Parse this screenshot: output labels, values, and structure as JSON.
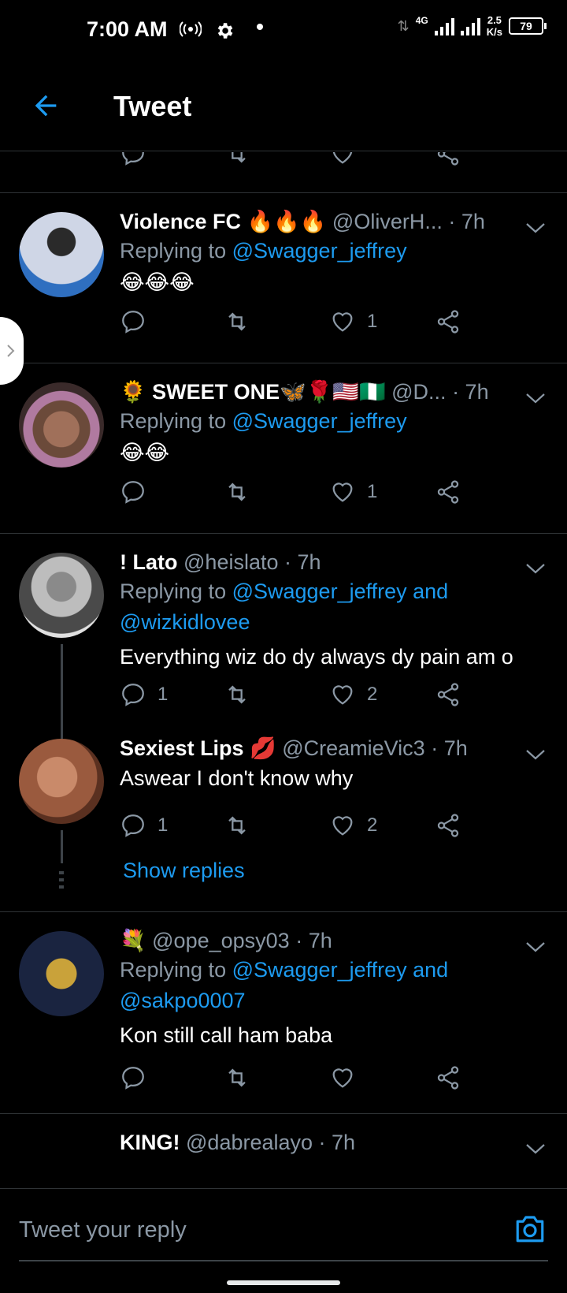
{
  "status_bar": {
    "time": "7:00 AM",
    "network": "4G",
    "speed_value": "2.5",
    "speed_unit": "K/s",
    "battery": "79"
  },
  "header": {
    "title": "Tweet"
  },
  "tweets": [
    {
      "name": "Violence FC 🔥🔥🔥",
      "handle": "@OliverH...",
      "time": "· 7h",
      "reply_prefix": "Replying to ",
      "reply_to": "@Swagger_jeffrey",
      "text": "😂😂😂",
      "replies": "",
      "likes": "1"
    },
    {
      "name": "🌻 SWEET ONE🦋🌹🇺🇸🇳🇬",
      "handle": "@D...",
      "time": "· 7h",
      "reply_prefix": "Replying to ",
      "reply_to": "@Swagger_jeffrey",
      "text": "😂😂",
      "replies": "",
      "likes": "1"
    },
    {
      "name": "! Lato",
      "handle": "@heislato",
      "time": "· 7h",
      "reply_prefix": "Replying to ",
      "reply_to": "@Swagger_jeffrey and",
      "reply_to_2": "@wizkidlovee",
      "text": "Everything wiz do dy always dy pain am o",
      "replies": "1",
      "likes": "2"
    },
    {
      "name": "Sexiest Lips 💋",
      "handle": "@CreamieVic3",
      "time": "· 7h",
      "text": "Aswear I don't know why",
      "replies": "1",
      "likes": "2"
    },
    {
      "name": "💐",
      "handle": "@ope_opsy03",
      "time": "· 7h",
      "reply_prefix": "Replying to ",
      "reply_to": "@Swagger_jeffrey and",
      "reply_to_2": "@sakpo0007",
      "text": "Kon still call ham baba",
      "replies": "",
      "likes": ""
    },
    {
      "name": "KING!",
      "handle": "@dabrealayo",
      "time": "· 7h"
    }
  ],
  "show_replies": "Show replies",
  "compose": {
    "placeholder": "Tweet your reply"
  },
  "colors": {
    "accent": "#1d9bf0",
    "muted": "#8b98a5",
    "background": "#000000"
  }
}
